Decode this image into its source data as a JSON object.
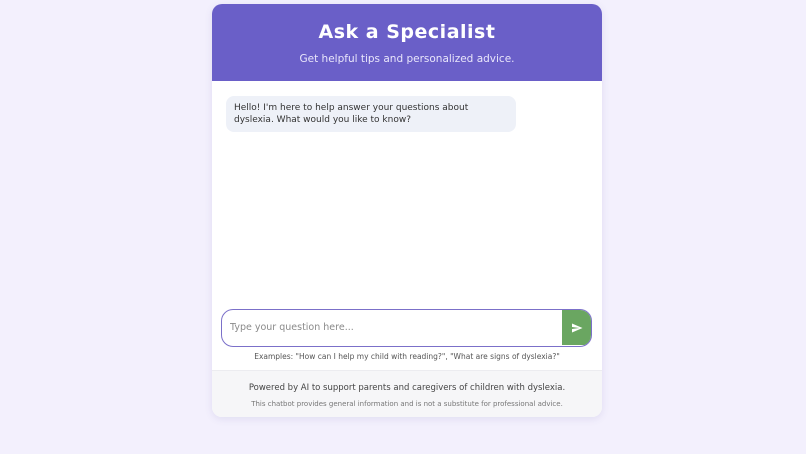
{
  "header": {
    "title": "Ask a Specialist",
    "subtitle": "Get helpful tips and personalized advice."
  },
  "chat": {
    "messages": [
      {
        "sender": "bot",
        "text": "Hello! I'm here to help answer your questions about dyslexia. What would you like to know?"
      }
    ]
  },
  "input": {
    "value": "",
    "placeholder": "Type your question here...",
    "send_icon": "send-icon"
  },
  "examples": "Examples: \"How can I help my child with reading?\", \"What are signs of dyslexia?\"",
  "footer": {
    "powered": "Powered by AI to support parents and caregivers of children with dyslexia.",
    "disclaimer": "This chatbot provides general information and is not a substitute for professional advice."
  },
  "colors": {
    "header": "#6a5fc8",
    "send_button": "#6aa661",
    "background": "#f3f0fd",
    "bubble": "#eef1f8"
  }
}
